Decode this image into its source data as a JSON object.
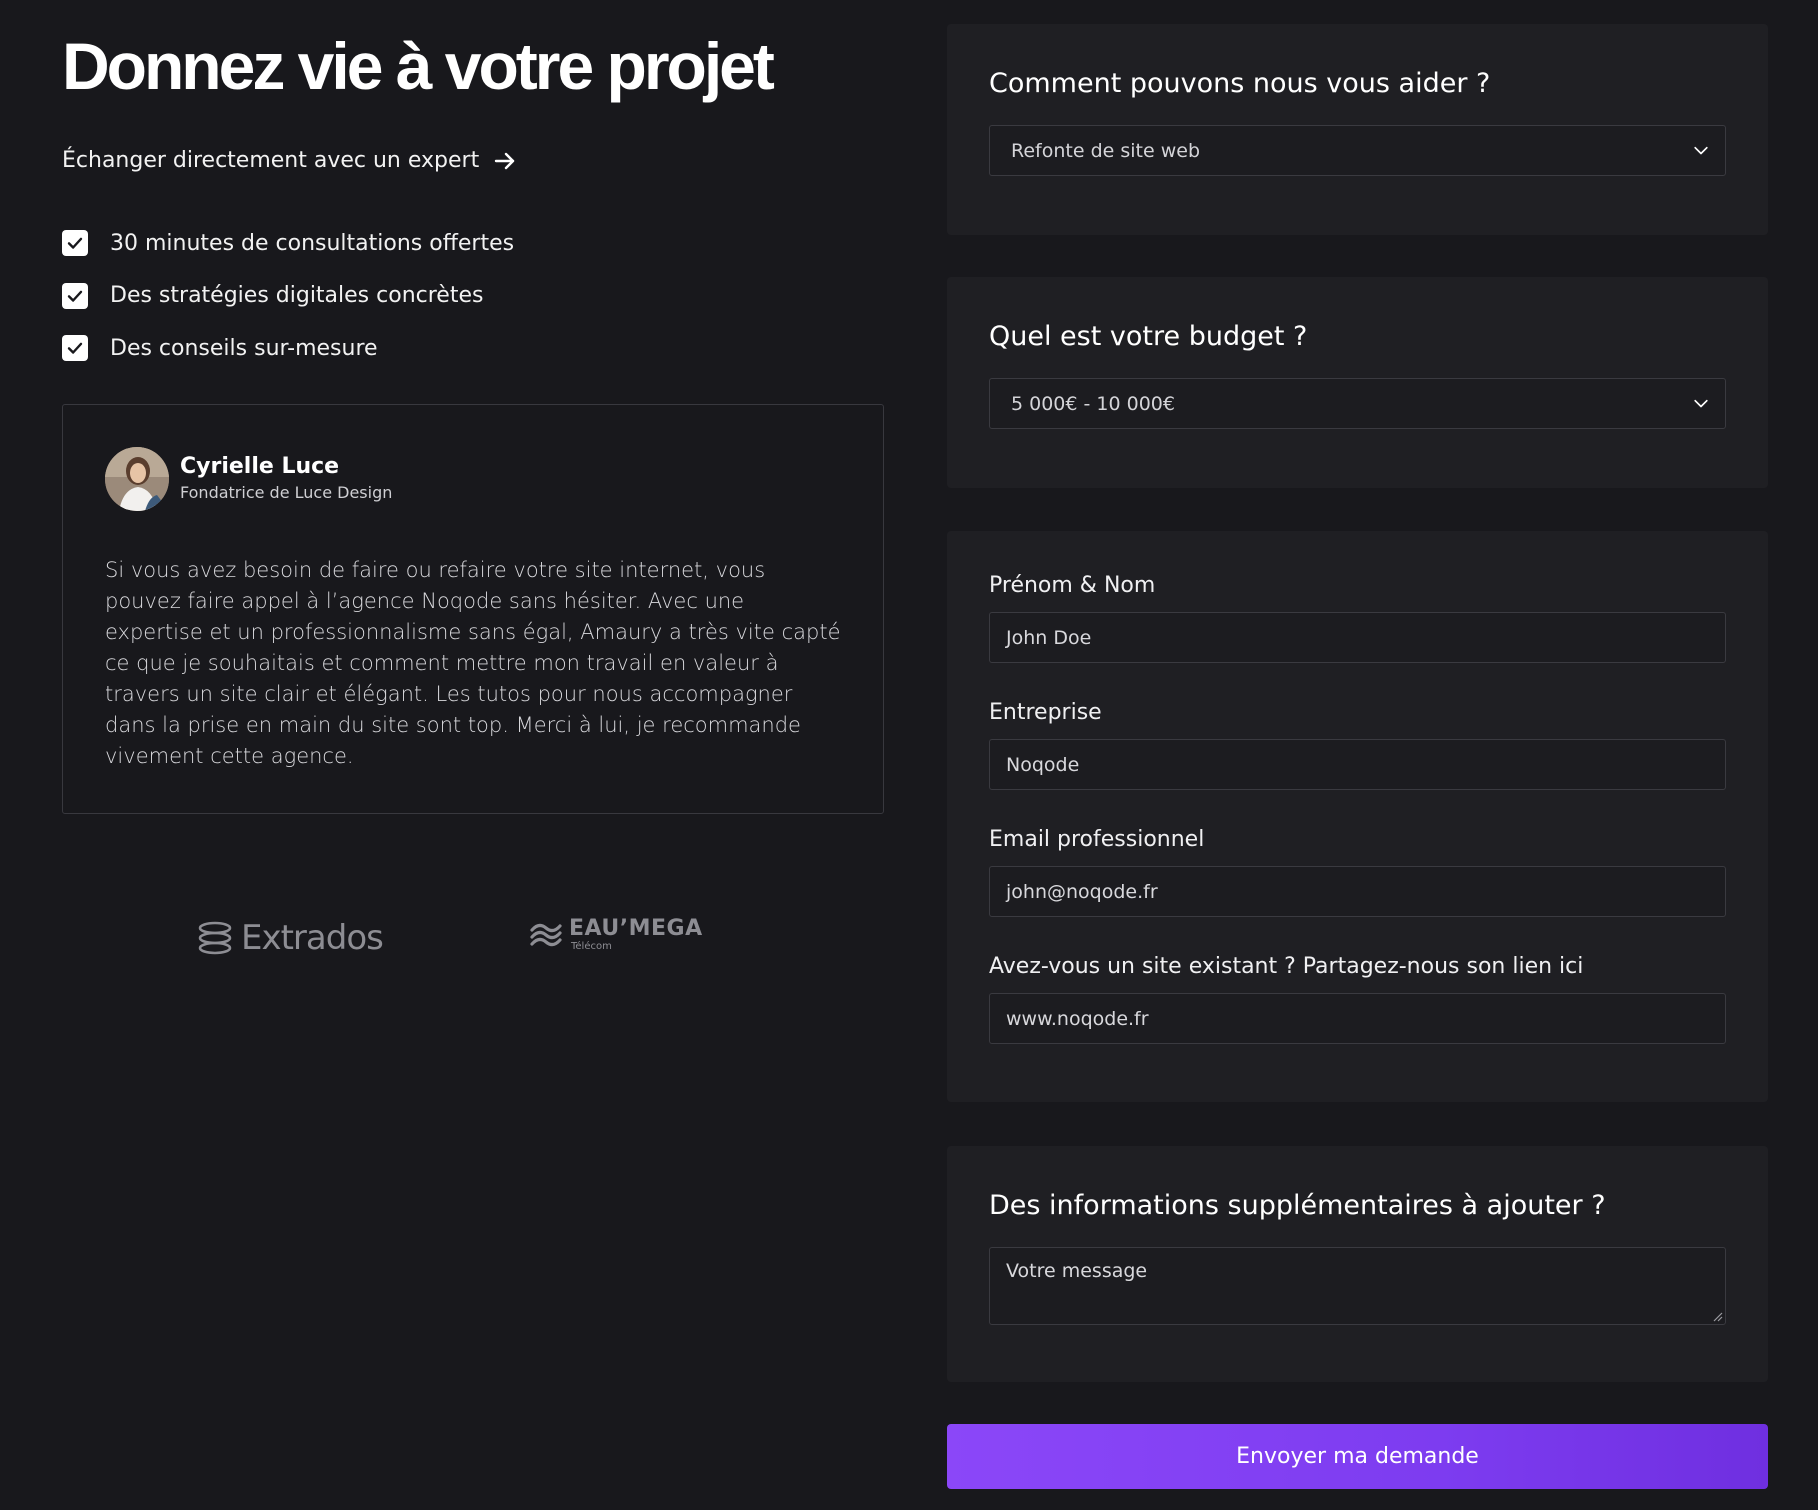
{
  "hero": {
    "title": "Donnez vie à votre projet",
    "expert_link": "Échanger directement avec un expert"
  },
  "benefits": [
    "30 minutes de consultations offertes",
    "Des stratégies digitales concrètes",
    "Des conseils sur-mesure"
  ],
  "testimonial": {
    "name": "Cyrielle Luce",
    "role": "Fondatrice de Luce Design",
    "quote": "Si vous avez besoin de faire ou refaire votre site internet, vous pouvez faire appel à l’agence Noqode sans hésiter. Avec une expertise et un professionnalisme sans égal, Amaury a très vite capté ce que je souhaitais et comment mettre mon travail en valeur à travers un site clair et élégant. Les tutos pour nous accompagner dans la prise en main du site sont top. Merci à lui, je recommande vivement cette agence."
  },
  "logos": {
    "extrados": "Extrados",
    "eaumega_main": "EAU’MEGA",
    "eaumega_sub": "Télécom"
  },
  "form": {
    "help": {
      "title": "Comment pouvons nous vous aider ?",
      "selected": "Refonte de site web"
    },
    "budget": {
      "title": "Quel est votre budget ?",
      "selected": "5 000€ - 10 000€"
    },
    "contact": {
      "name_label": "Prénom & Nom",
      "name_value": "John Doe",
      "company_label": "Entreprise",
      "company_value": "Noqode",
      "email_label": "Email professionnel",
      "email_value": "john@noqode.fr",
      "site_label": "Avez-vous un site existant ? Partagez-nous son lien ici",
      "site_value": "www.noqode.fr"
    },
    "extra": {
      "title": "Des informations supplémentaires à ajouter ?",
      "placeholder": "Votre message"
    },
    "submit_label": "Envoyer ma demande"
  },
  "colors": {
    "background": "#18181c",
    "card": "#1f1f23",
    "accent": "#8b47f8"
  }
}
